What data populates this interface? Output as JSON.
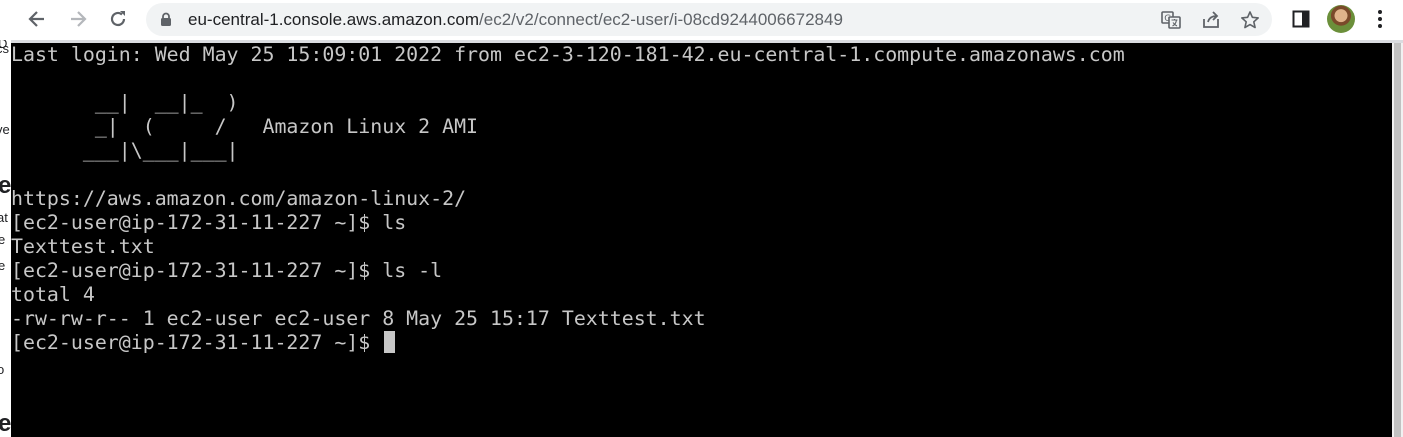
{
  "browser": {
    "url_host": "eu-central-1.console.aws.amazon.com",
    "url_path": "/ec2/v2/connect/ec2-user/i-08cd9244006672849",
    "icons": {
      "back": "back-arrow-icon",
      "forward": "forward-arrow-icon",
      "reload": "reload-icon",
      "lock": "lock-icon",
      "translate": "translate-icon",
      "share": "share-icon",
      "bookmark": "star-icon",
      "sidepanel": "side-panel-icon",
      "menu": "kebab-menu-icon"
    }
  },
  "underlying_page": {
    "fragments": [
      "D",
      "cs",
      "ve",
      "e",
      "at",
      "e",
      "e",
      "o",
      "e"
    ]
  },
  "terminal": {
    "lines": [
      "Last login: Wed May 25 15:09:01 2022 from ec2-3-120-181-42.eu-central-1.compute.amazonaws.com",
      "",
      "       __|  __|_  )",
      "       _|  (     /   Amazon Linux 2 AMI",
      "      ___|\\___|___|",
      "",
      "https://aws.amazon.com/amazon-linux-2/",
      "[ec2-user@ip-172-31-11-227 ~]$ ls",
      "Texttest.txt",
      "[ec2-user@ip-172-31-11-227 ~]$ ls -l",
      "total 4",
      "-rw-rw-r-- 1 ec2-user ec2-user 8 May 25 15:17 Texttest.txt",
      "[ec2-user@ip-172-31-11-227 ~]$ "
    ],
    "colors": {
      "background": "#000000",
      "foreground": "#c7c7c7"
    }
  }
}
